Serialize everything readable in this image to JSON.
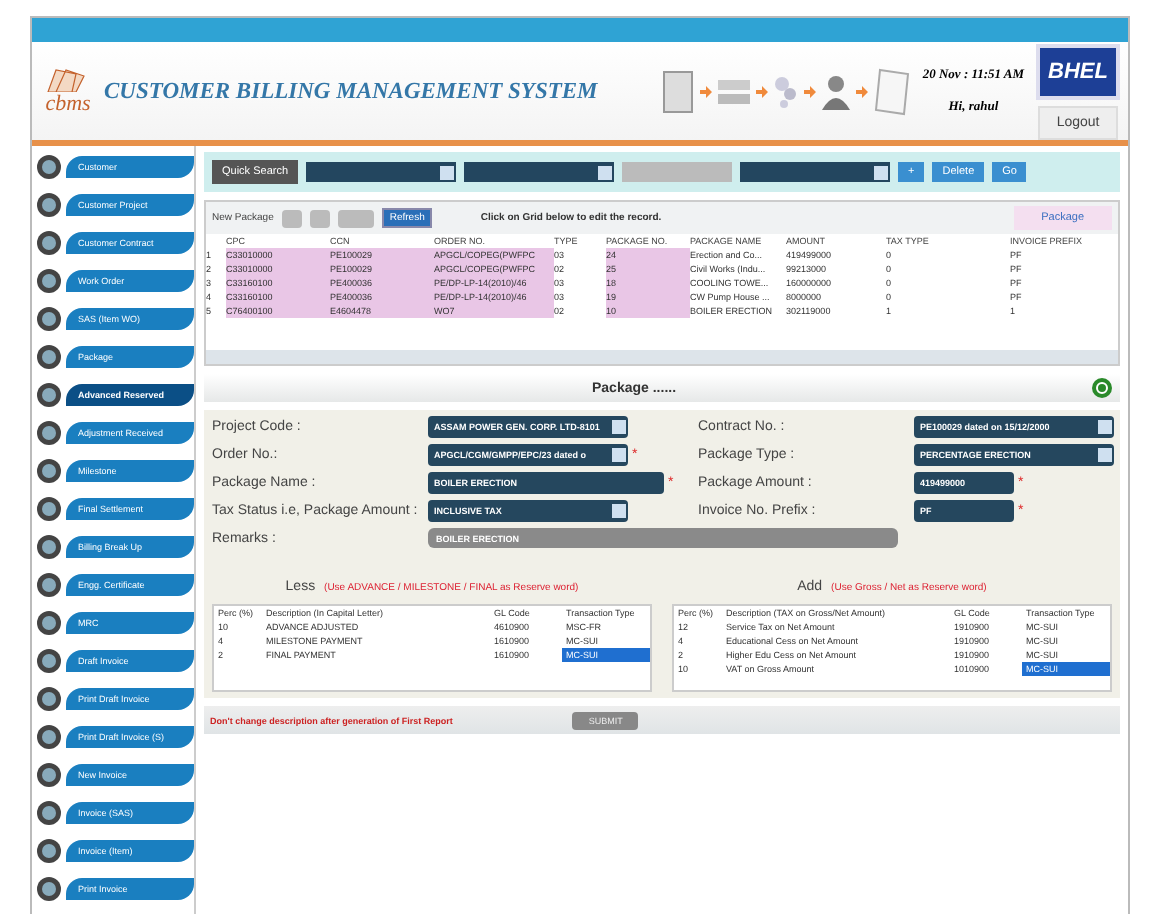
{
  "header": {
    "logo": "cbms",
    "title": "CUSTOMER BILLING MANAGEMENT SYSTEM",
    "date": "20 Nov : 11:51 AM",
    "user": "Hi, rahul",
    "brand": "BHEL",
    "logout": "Logout"
  },
  "sidebar": {
    "items": [
      {
        "label": "Customer",
        "selected": false
      },
      {
        "label": "Customer Project",
        "selected": false
      },
      {
        "label": "Customer Contract",
        "selected": false
      },
      {
        "label": "Work Order",
        "selected": false
      },
      {
        "label": "SAS (Item WO)",
        "selected": false
      },
      {
        "label": "Package",
        "selected": false
      },
      {
        "label": "Advanced Reserved",
        "selected": true
      },
      {
        "label": "Adjustment Received",
        "selected": false
      },
      {
        "label": "Milestone",
        "selected": false
      },
      {
        "label": "Final Settlement",
        "selected": false
      },
      {
        "label": "Billing Break Up",
        "selected": false
      },
      {
        "label": "Engg. Certificate",
        "selected": false
      },
      {
        "label": "MRC",
        "selected": false
      },
      {
        "label": "Draft Invoice",
        "selected": false
      },
      {
        "label": "Print Draft Invoice",
        "selected": false
      },
      {
        "label": "Print Draft Invoice (S)",
        "selected": false
      },
      {
        "label": "New Invoice",
        "selected": false
      },
      {
        "label": "Invoice (SAS)",
        "selected": false
      },
      {
        "label": "Invoice (Item)",
        "selected": false
      },
      {
        "label": "Print Invoice",
        "selected": false
      }
    ]
  },
  "quick_search": {
    "label": "Quick Search",
    "buttons": [
      "+",
      "Delete",
      "Go"
    ]
  },
  "grid": {
    "new_button": "New Package",
    "refresh": "Refresh",
    "hint": "Click on Grid below to edit the record.",
    "tab": "Package",
    "columns": [
      "CPC",
      "CCN",
      "ORDER NO.",
      "TYPE",
      "PACKAGE NO.",
      "PACKAGE NAME",
      "AMOUNT",
      "TAX TYPE",
      "INVOICE PREFIX"
    ],
    "rows": [
      {
        "number": "1",
        "cells": [
          "C33010000",
          "PE100029",
          "APGCL/COPEG(PWFPC",
          "03",
          "24",
          "Erection and Co...",
          "419499000",
          "0",
          "PF"
        ]
      },
      {
        "number": "2",
        "cells": [
          "C33010000",
          "PE100029",
          "APGCL/COPEG(PWFPC",
          "02",
          "25",
          "Civil Works (Indu...",
          "99213000",
          "0",
          "PF"
        ]
      },
      {
        "number": "3",
        "cells": [
          "C33160100",
          "PE400036",
          "PE/DP-LP-14(2010)/46",
          "03",
          "18",
          "COOLING TOWE...",
          "160000000",
          "0",
          "PF"
        ]
      },
      {
        "number": "4",
        "cells": [
          "C33160100",
          "PE400036",
          "PE/DP-LP-14(2010)/46",
          "03",
          "19",
          "CW Pump House ...",
          "8000000",
          "0",
          "PF"
        ]
      },
      {
        "number": "5",
        "cells": [
          "C76400100",
          "E4604478",
          "WO7",
          "02",
          "10",
          "BOILER ERECTION",
          "302119000",
          "1",
          "1"
        ]
      }
    ]
  },
  "package_form": {
    "title": "Package ......",
    "fields": [
      {
        "label": "Project Code :",
        "value": "ASSAM POWER GEN. CORP. LTD-8101",
        "kind": "select"
      },
      {
        "label": "Contract No. :",
        "value": "PE100029 dated on 15/12/2000",
        "kind": "select"
      },
      {
        "label": "Order No.:",
        "value": "APGCL/CGM/GMPP/EPC/23 dated o",
        "kind": "select",
        "mark": "*"
      },
      {
        "label": "Package Type :",
        "value": "PERCENTAGE ERECTION",
        "kind": "select"
      },
      {
        "label": "Package Name :",
        "value": "BOILER ERECTION",
        "kind": "text",
        "mark": "*"
      },
      {
        "label": "Package Amount :",
        "value": "419499000",
        "kind": "text",
        "mark": "*"
      },
      {
        "label": "Tax Status i.e, Package Amount :",
        "value": "INCLUSIVE TAX",
        "kind": "select"
      },
      {
        "label": "Invoice No. Prefix :",
        "value": "PF",
        "kind": "text",
        "mark": "*"
      }
    ],
    "remarks": {
      "label": "Remarks :",
      "value": "BOILER ERECTION"
    }
  },
  "less": {
    "title": "Less",
    "note": "(Use ADVANCE / MILESTONE / FINAL as Reserve word)",
    "columns": [
      "Perc (%)",
      "Description (In Capital Letter)",
      "GL Code",
      "Transaction Type"
    ],
    "rows": [
      {
        "cells": [
          "10",
          "ADVANCE ADJUSTED",
          "4610900",
          "MSC-FR"
        ],
        "selected": false
      },
      {
        "cells": [
          "4",
          "MILESTONE PAYMENT",
          "1610900",
          "MC-SUI"
        ],
        "selected": false
      },
      {
        "cells": [
          "2",
          "FINAL PAYMENT",
          "1610900",
          "MC-SUI"
        ],
        "selected": true
      }
    ]
  },
  "add": {
    "title": "Add",
    "note": "(Use Gross / Net as Reserve word)",
    "columns": [
      "Perc (%)",
      "Description (TAX on Gross/Net Amount)",
      "GL Code",
      "Transaction Type"
    ],
    "rows": [
      {
        "cells": [
          "12",
          "Service Tax on Net Amount",
          "1910900",
          "MC-SUI"
        ],
        "selected": false
      },
      {
        "cells": [
          "4",
          "Educational Cess on Net Amount",
          "1910900",
          "MC-SUI"
        ],
        "selected": false
      },
      {
        "cells": [
          "2",
          "Higher Edu Cess on Net Amount",
          "1910900",
          "MC-SUI"
        ],
        "selected": false
      },
      {
        "cells": [
          "10",
          "VAT on Gross Amount",
          "1010900",
          "MC-SUI"
        ],
        "selected": true
      }
    ]
  },
  "footer": {
    "warning": "Don't change description after generation of First Report",
    "submit": "SUBMIT"
  }
}
